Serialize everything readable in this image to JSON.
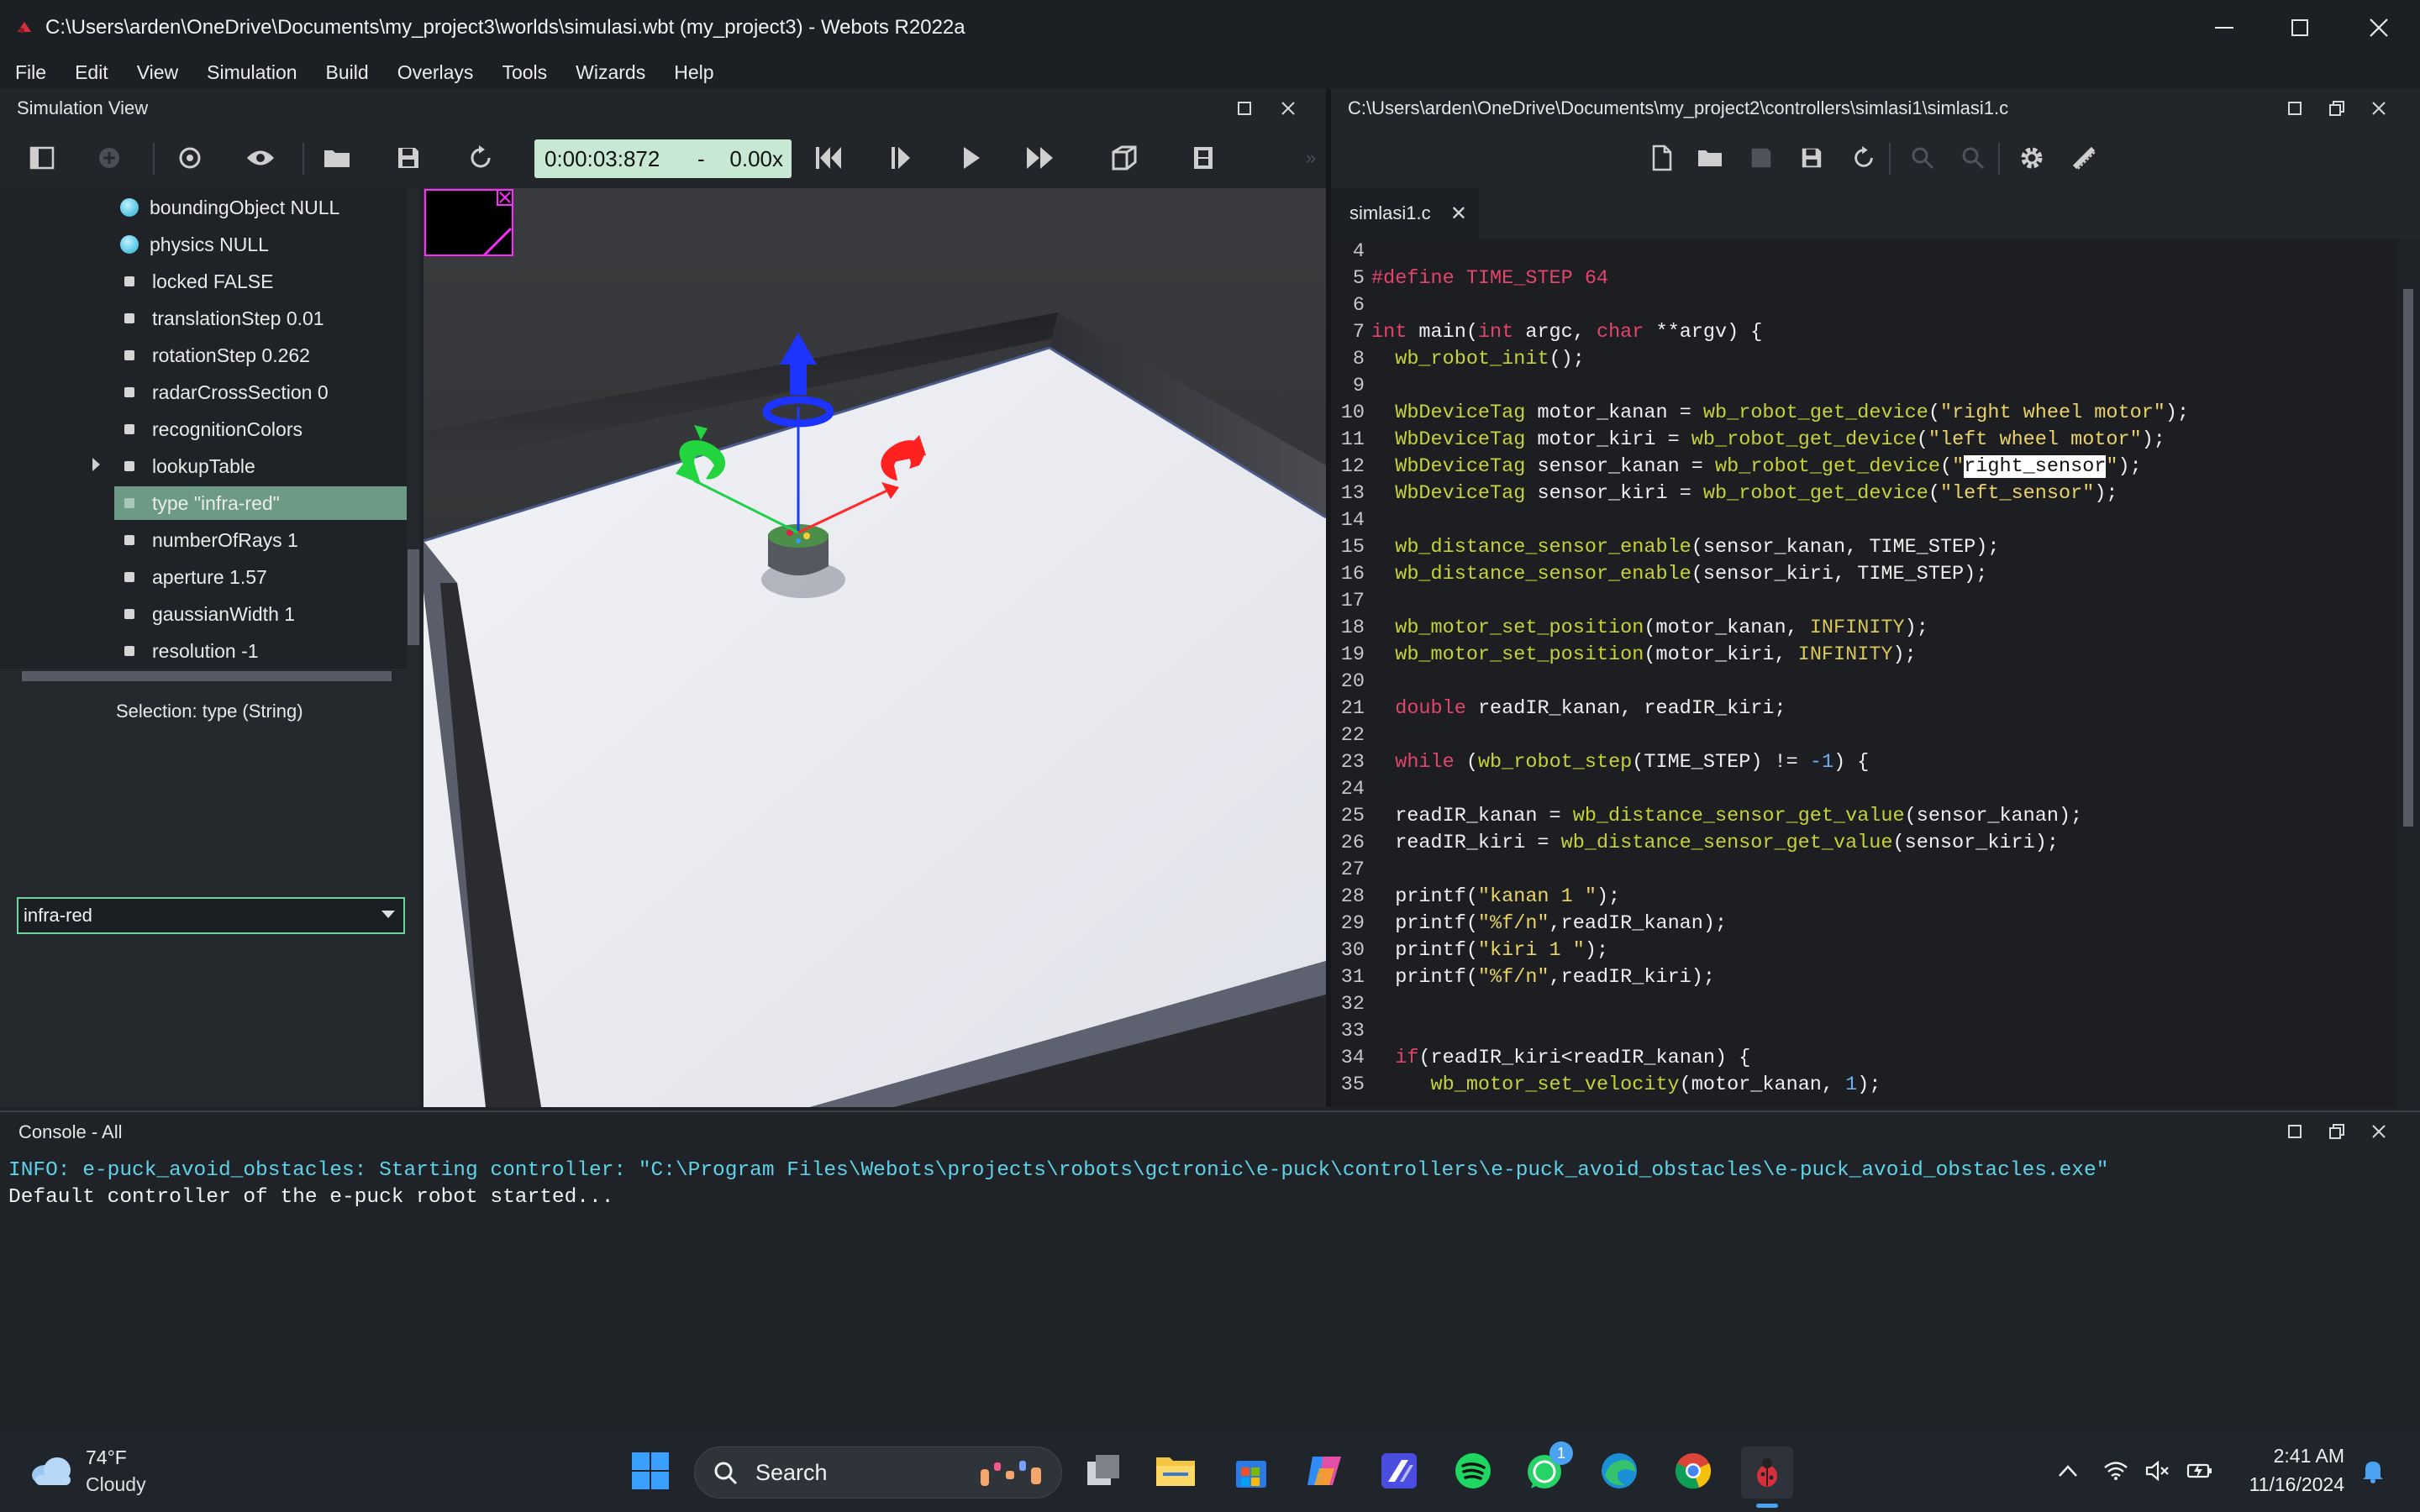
{
  "window": {
    "title": "C:\\Users\\arden\\OneDrive\\Documents\\my_project3\\worlds\\simulasi.wbt (my_project3) - Webots R2022a",
    "controls": [
      "minimize",
      "maximize",
      "close"
    ]
  },
  "menu": [
    "File",
    "Edit",
    "View",
    "Simulation",
    "Build",
    "Overlays",
    "Tools",
    "Wizards",
    "Help"
  ],
  "simulation_view": {
    "title": "Simulation View",
    "time": "0:00:03:872",
    "time_sep": "-",
    "speed": "0.00x"
  },
  "scene_tree": {
    "items": [
      {
        "label": "boundingObject NULL",
        "kind": "node"
      },
      {
        "label": "physics NULL",
        "kind": "node"
      },
      {
        "label": "locked FALSE",
        "kind": "field"
      },
      {
        "label": "translationStep 0.01",
        "kind": "field"
      },
      {
        "label": "rotationStep 0.262",
        "kind": "field"
      },
      {
        "label": "radarCrossSection 0",
        "kind": "field"
      },
      {
        "label": "recognitionColors",
        "kind": "field"
      },
      {
        "label": "lookupTable",
        "kind": "field",
        "expandable": true
      },
      {
        "label": "type \"infra-red\"",
        "kind": "field",
        "selected": true
      },
      {
        "label": "numberOfRays 1",
        "kind": "field"
      },
      {
        "label": "aperture 1.57",
        "kind": "field"
      },
      {
        "label": "gaussianWidth 1",
        "kind": "field"
      },
      {
        "label": "resolution -1",
        "kind": "field"
      }
    ],
    "selection_label": "Selection: type (String)",
    "type_value": "infra-red"
  },
  "editor": {
    "path": "C:\\Users\\arden\\OneDrive\\Documents\\my_project2\\controllers\\simlasi1\\simlasi1.c",
    "tab": "simlasi1.c",
    "lines": [
      {
        "n": "4",
        "code": ""
      },
      {
        "n": "5",
        "code": "#define TIME_STEP 64"
      },
      {
        "n": "6",
        "code": ""
      },
      {
        "n": "7",
        "code": "int main(int argc, char **argv) {"
      },
      {
        "n": "8",
        "code": "  wb_robot_init();"
      },
      {
        "n": "9",
        "code": ""
      },
      {
        "n": "10",
        "code": "  WbDeviceTag motor_kanan = wb_robot_get_device(\"right wheel motor\");"
      },
      {
        "n": "11",
        "code": "  WbDeviceTag motor_kiri = wb_robot_get_device(\"left wheel motor\");"
      },
      {
        "n": "12",
        "code": "  WbDeviceTag sensor_kanan = wb_robot_get_device(\"right_sensor\");"
      },
      {
        "n": "13",
        "code": "  WbDeviceTag sensor_kiri = wb_robot_get_device(\"left_sensor\");"
      },
      {
        "n": "14",
        "code": ""
      },
      {
        "n": "15",
        "code": "  wb_distance_sensor_enable(sensor_kanan, TIME_STEP);"
      },
      {
        "n": "16",
        "code": "  wb_distance_sensor_enable(sensor_kiri, TIME_STEP);"
      },
      {
        "n": "17",
        "code": ""
      },
      {
        "n": "18",
        "code": "  wb_motor_set_position(motor_kanan, INFINITY);"
      },
      {
        "n": "19",
        "code": "  wb_motor_set_position(motor_kiri, INFINITY);"
      },
      {
        "n": "20",
        "code": ""
      },
      {
        "n": "21",
        "code": "  double readIR_kanan, readIR_kiri;"
      },
      {
        "n": "22",
        "code": ""
      },
      {
        "n": "23",
        "code": "  while (wb_robot_step(TIME_STEP) != -1) {"
      },
      {
        "n": "24",
        "code": ""
      },
      {
        "n": "25",
        "code": "  readIR_kanan = wb_distance_sensor_get_value(sensor_kanan);"
      },
      {
        "n": "26",
        "code": "  readIR_kiri = wb_distance_sensor_get_value(sensor_kiri);"
      },
      {
        "n": "27",
        "code": ""
      },
      {
        "n": "28",
        "code": "  printf(\"kanan 1 \");"
      },
      {
        "n": "29",
        "code": "  printf(\"%f/n\",readIR_kanan);"
      },
      {
        "n": "30",
        "code": "  printf(\"kiri 1 \");"
      },
      {
        "n": "31",
        "code": "  printf(\"%f/n\",readIR_kiri);"
      },
      {
        "n": "32",
        "code": ""
      },
      {
        "n": "33",
        "code": ""
      },
      {
        "n": "34",
        "code": "  if(readIR_kiri<readIR_kanan) {"
      },
      {
        "n": "35",
        "code": "     wb_motor_set_velocity(motor_kanan, 1);"
      }
    ]
  },
  "console": {
    "title": "Console - All",
    "lines": [
      {
        "kind": "info",
        "text": "INFO: e-puck_avoid_obstacles: Starting controller: \"C:\\Program Files\\Webots\\projects\\robots\\gctronic\\e-puck\\controllers\\e-puck_avoid_obstacles\\e-puck_avoid_obstacles.exe\""
      },
      {
        "kind": "plain",
        "text": "Default controller of the e-puck robot started..."
      }
    ]
  },
  "taskbar": {
    "weather_temp": "74°F",
    "weather_desc": "Cloudy",
    "search_placeholder": "Search",
    "whatsapp_badge": "1",
    "time": "2:41 AM",
    "date": "11/16/2024"
  },
  "colors": {
    "accent_green": "#c7e9d4",
    "selection_row": "#6c9a85",
    "keyword": "#e2456b",
    "function": "#c7d23a",
    "string": "#e9d36a",
    "number": "#6ab0f5",
    "console_info": "#5ed2e8"
  }
}
